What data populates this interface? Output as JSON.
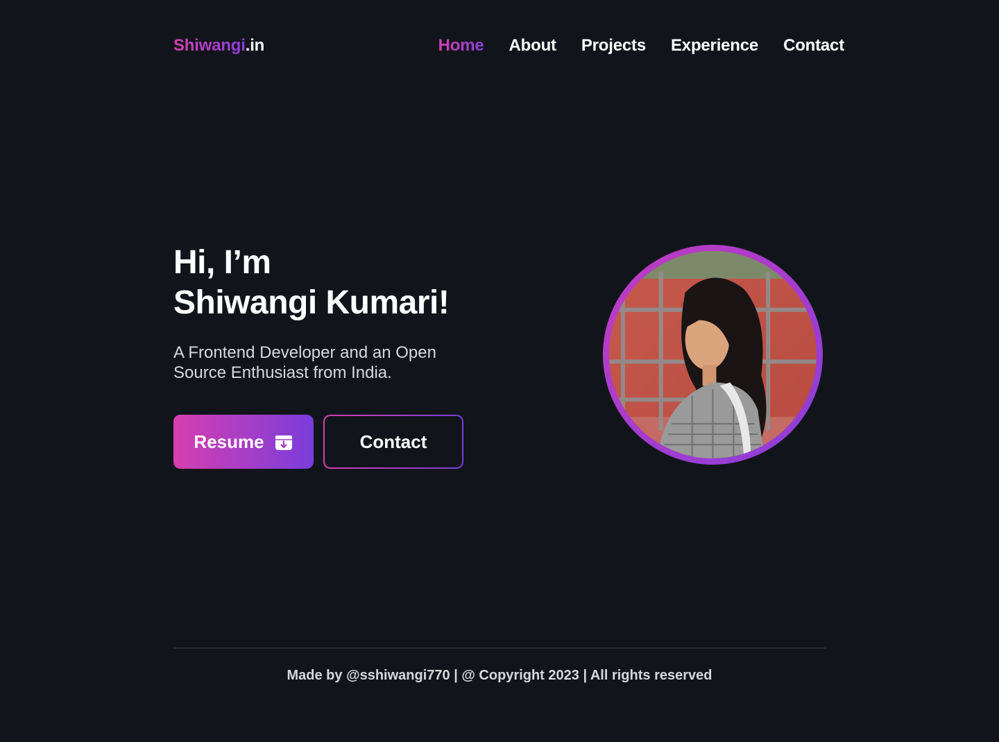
{
  "header": {
    "logo_brand": "Shiwangi",
    "logo_tld": ".in",
    "nav": [
      {
        "label": "Home",
        "active": true
      },
      {
        "label": "About",
        "active": false
      },
      {
        "label": "Projects",
        "active": false
      },
      {
        "label": "Experience",
        "active": false
      },
      {
        "label": "Contact",
        "active": false
      }
    ]
  },
  "hero": {
    "greeting": "Hi, I’m",
    "name": "Shiwangi Kumari!",
    "tagline": "A Frontend Developer and an Open Source Enthusiast from India.",
    "resume_label": "Resume",
    "resume_icon": "download-icon",
    "contact_label": "Contact"
  },
  "footer": {
    "text": "Made by @sshiwangi770 | @ Copyright 2023 | All rights reserved"
  },
  "colors": {
    "background": "#11151b",
    "accent_start": "#d63fb0",
    "accent_end": "#7a3ddb",
    "text": "#ffffff",
    "muted_text": "#d8d8dc"
  }
}
